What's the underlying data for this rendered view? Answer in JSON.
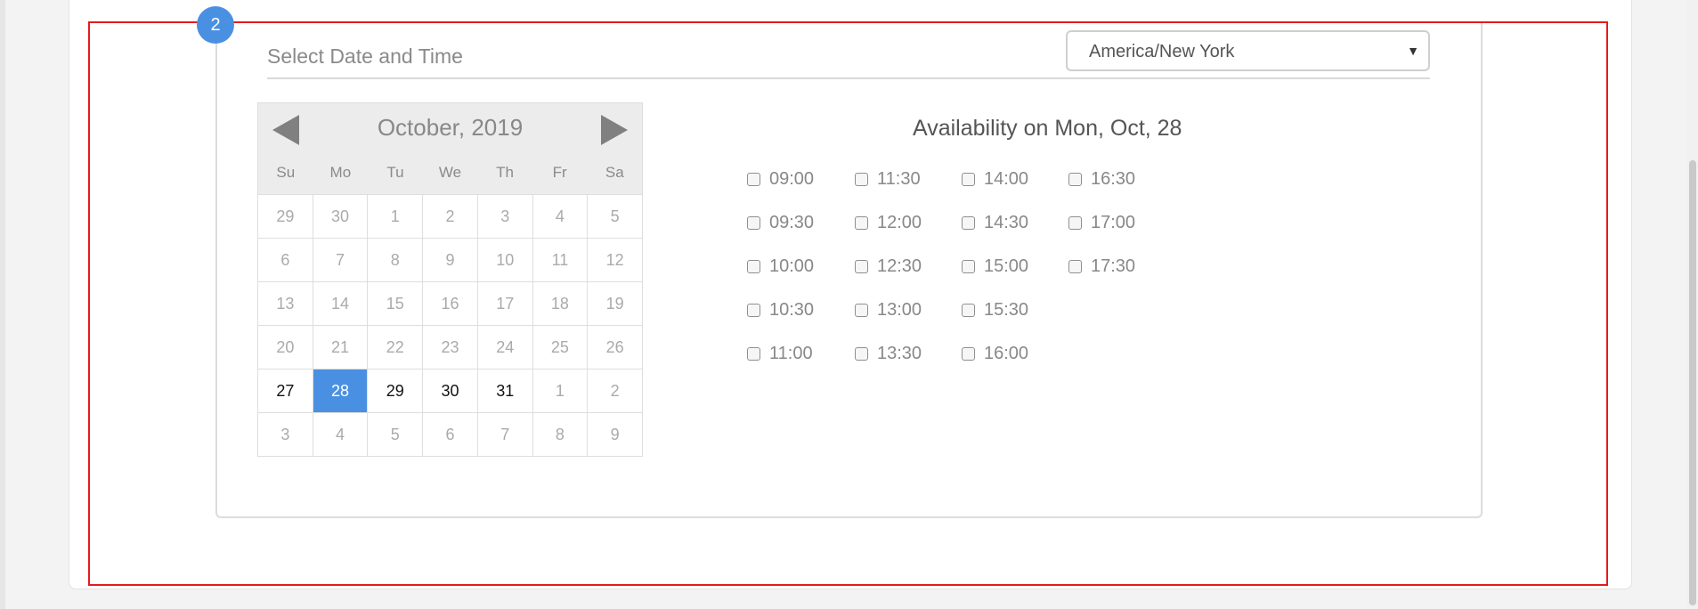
{
  "step": {
    "number": "2"
  },
  "section": {
    "title": "Select Date and Time"
  },
  "timezone": {
    "selected": "America/New York"
  },
  "calendar": {
    "month_label": "October, 2019",
    "weekdays": [
      "Su",
      "Mo",
      "Tu",
      "We",
      "Th",
      "Fr",
      "Sa"
    ],
    "weeks": [
      [
        "29",
        "30",
        "1",
        "2",
        "3",
        "4",
        "5"
      ],
      [
        "6",
        "7",
        "8",
        "9",
        "10",
        "11",
        "12"
      ],
      [
        "13",
        "14",
        "15",
        "16",
        "17",
        "18",
        "19"
      ],
      [
        "20",
        "21",
        "22",
        "23",
        "24",
        "25",
        "26"
      ],
      [
        "27",
        "28",
        "29",
        "30",
        "31",
        "1",
        "2"
      ],
      [
        "3",
        "4",
        "5",
        "6",
        "7",
        "8",
        "9"
      ]
    ],
    "available_days": [
      "27",
      "29",
      "30",
      "31"
    ],
    "selected_day": "28",
    "colors": {
      "selected": "#4a90e2",
      "available": "#111111",
      "unavailable": "#aaaaaa"
    }
  },
  "availability": {
    "title": "Availability on Mon, Oct, 28",
    "columns": [
      [
        "09:00",
        "09:30",
        "10:00",
        "10:30",
        "11:00"
      ],
      [
        "11:30",
        "12:00",
        "12:30",
        "13:00",
        "13:30"
      ],
      [
        "14:00",
        "14:30",
        "15:00",
        "15:30",
        "16:00"
      ],
      [
        "16:30",
        "17:00",
        "17:30"
      ]
    ]
  },
  "colors": {
    "highlight": "#e41b1b",
    "badge": "#4a90e2"
  }
}
